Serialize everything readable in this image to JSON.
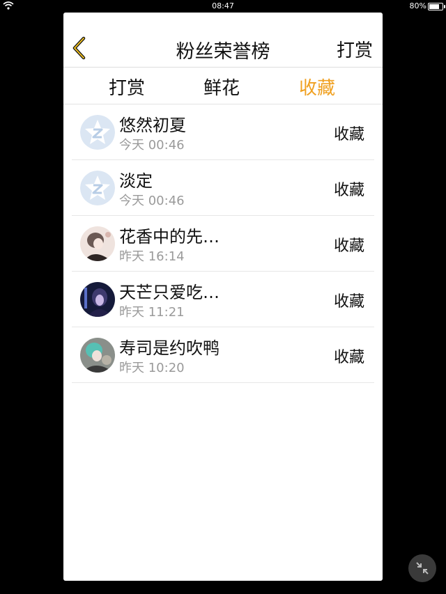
{
  "status_bar": {
    "time": "08:47",
    "battery": "80%",
    "battery_level": 0.8
  },
  "nav": {
    "title": "粉丝荣誉榜",
    "action_label": "打赏"
  },
  "tabs": [
    {
      "label": "打赏",
      "active": false
    },
    {
      "label": "鲜花",
      "active": false
    },
    {
      "label": "收藏",
      "active": true
    }
  ],
  "colors": {
    "accent": "#f0a020",
    "placeholder_avatar": "#dbe6f3"
  },
  "list": [
    {
      "name": "悠然初夏",
      "time": "今天 00:46",
      "action": "收藏",
      "avatar": "placeholder-avatar-icon"
    },
    {
      "name": "淡定",
      "time": "今天 00:46",
      "action": "收藏",
      "avatar": "placeholder-avatar-icon"
    },
    {
      "name": "花香中的先…",
      "time": "昨天 16:14",
      "action": "收藏",
      "avatar": "user-photo"
    },
    {
      "name": "天芒只爱吃…",
      "time": "昨天 11:21",
      "action": "收藏",
      "avatar": "user-photo"
    },
    {
      "name": "寿司是约吹鸭",
      "time": "昨天 10:20",
      "action": "收藏",
      "avatar": "user-photo"
    }
  ],
  "icons": {
    "back": "chevron-left-icon",
    "wifi": "wifi-icon",
    "battery": "battery-icon",
    "float": "collapse-icon"
  }
}
